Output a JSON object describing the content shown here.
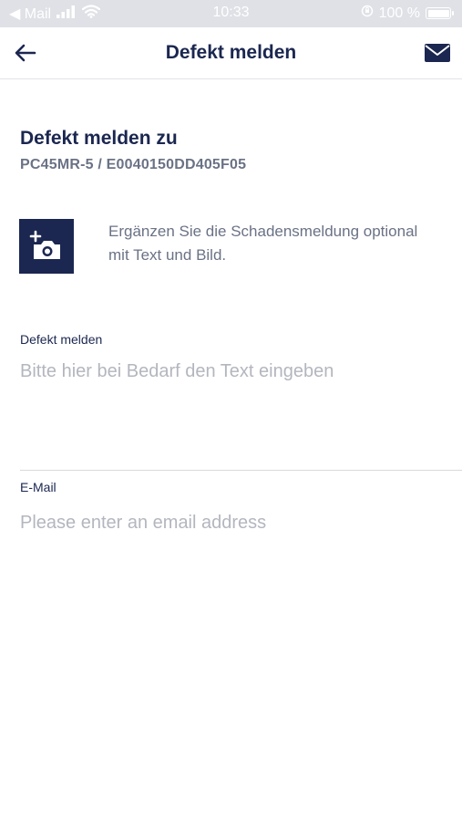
{
  "status_bar": {
    "back_app": "◀ Mail",
    "time": "10:33",
    "battery": "100 %",
    "battery_level": 1.0
  },
  "nav": {
    "title": "Defekt melden",
    "back_icon": "arrow-left-icon",
    "mail_icon": "envelope-icon"
  },
  "report": {
    "heading": "Defekt melden zu",
    "device_id": "PC45MR-5 / E0040150DD405F05",
    "camera_icon": "add-photo-icon",
    "hint": "Ergänzen Sie die Schadensmeldung optional mit Text und Bild."
  },
  "form": {
    "defekt_label": "Defekt melden",
    "defekt_placeholder": "Bitte hier bei Bedarf den Text eingeben",
    "email_label": "E-Mail",
    "email_placeholder": "Please enter an email address"
  },
  "colors": {
    "primary": "#1b2750",
    "secondary_text": "#6a7285",
    "placeholder": "#b3b6be",
    "status_bar_bg": "#dfe1e6"
  }
}
